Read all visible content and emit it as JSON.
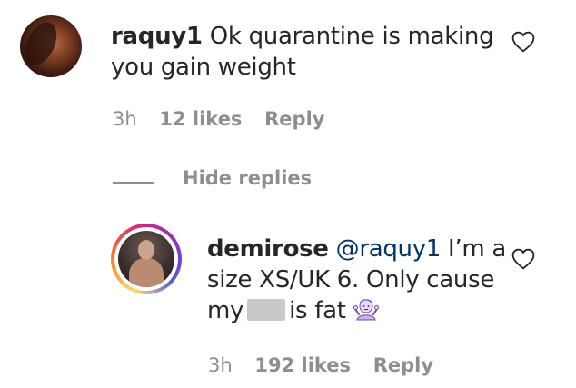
{
  "comment1": {
    "username": "raquy1",
    "text_line1": "Ok quarantine is making",
    "text_line2": "you gain weight",
    "time": "3h",
    "likes": "12 likes",
    "reply": "Reply"
  },
  "replies_toggle": {
    "label": "Hide replies"
  },
  "comment2": {
    "username": "demirose",
    "mention": "@raquy1",
    "text_line1_rest": "I’m a",
    "text_line2": "size XS/UK 6. Only cause",
    "text_line3_a": "my",
    "text_line3_b": "is fat",
    "time": "3h",
    "likes": "192 likes",
    "reply": "Reply"
  },
  "icons": {
    "like": "heart-outline-icon",
    "emoji": "person-shrugging-emoji"
  },
  "colors": {
    "text": "#262626",
    "meta": "#8e8e8e",
    "mention": "#003569"
  }
}
